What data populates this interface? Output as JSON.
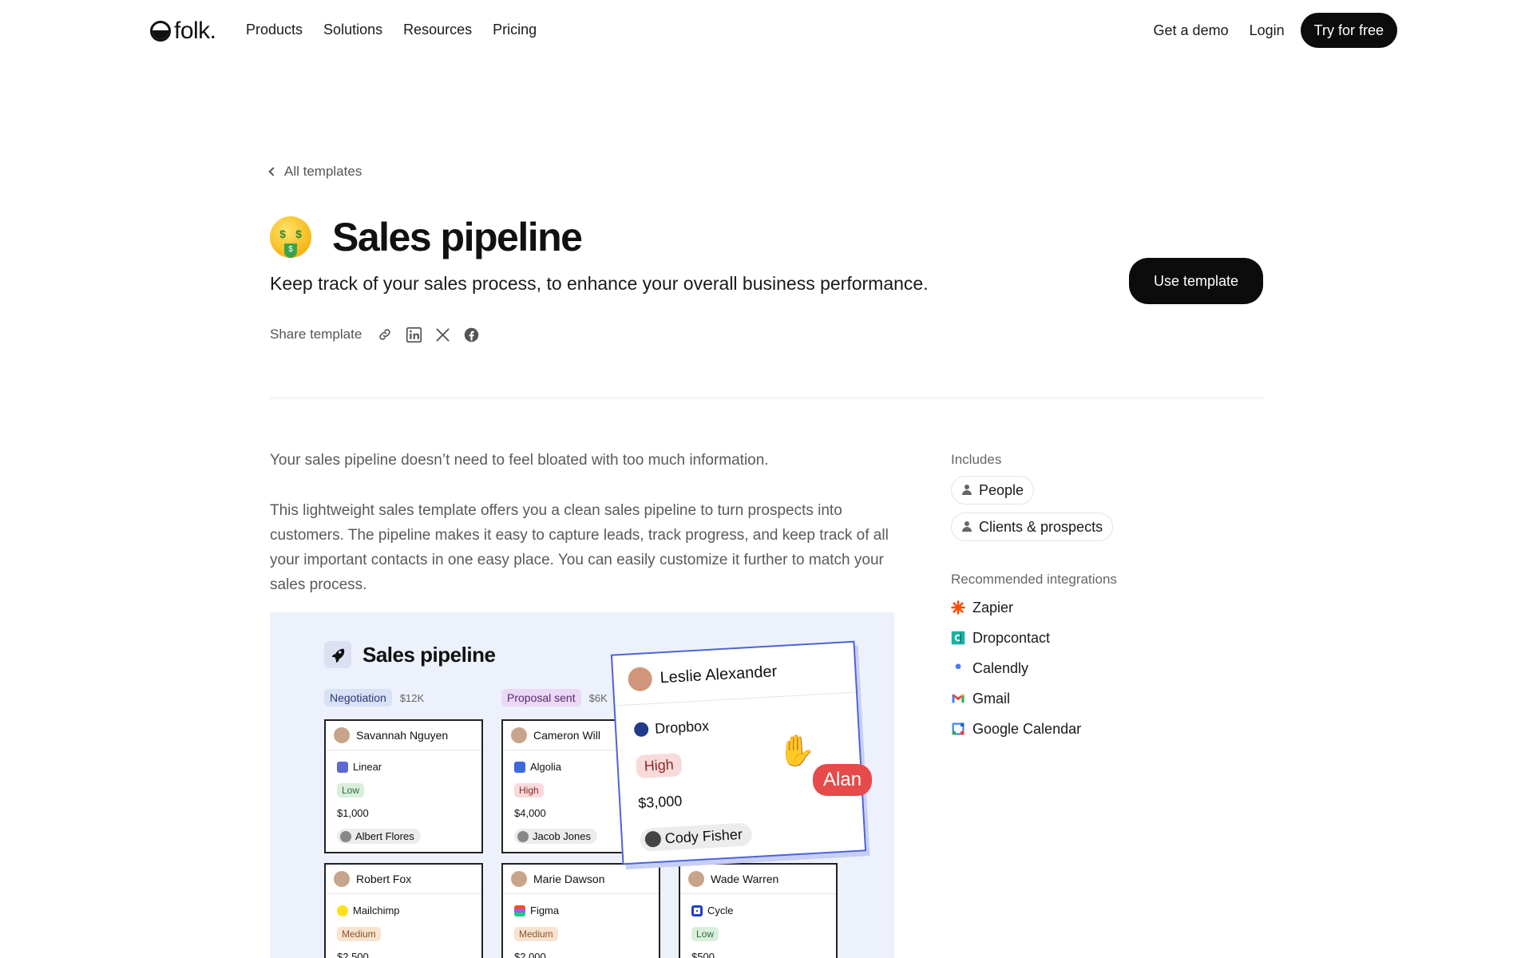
{
  "nav": {
    "logo_text": "folk.",
    "links": [
      "Products",
      "Solutions",
      "Resources",
      "Pricing"
    ],
    "demo": "Get a demo",
    "login": "Login",
    "cta": "Try for free"
  },
  "header": {
    "back": "All templates",
    "title": "Sales pipeline",
    "subtitle": "Keep track of your sales process, to enhance your overall business performance.",
    "use_template": "Use template",
    "share_label": "Share template"
  },
  "body": {
    "intro": "Your sales pipeline doesn’t need to feel bloated with too much information.",
    "description": "This lightweight sales template offers you a clean sales pipeline to turn prospects into customers. The pipeline makes it easy to capture leads, track progress, and keep track of all your important contacts in one easy place. You can easily customize it further to match your sales process."
  },
  "sidebar": {
    "includes_label": "Includes",
    "includes": [
      "People",
      "Clients & prospects"
    ],
    "integrations_label": "Recommended integrations",
    "integrations": [
      "Zapier",
      "Dropcontact",
      "Calendly",
      "Gmail",
      "Google Calendar"
    ]
  },
  "preview": {
    "title": "Sales pipeline",
    "columns": [
      {
        "stage": "Negotiation",
        "amount": "$12K"
      },
      {
        "stage": "Proposal sent",
        "amount": "$6K"
      }
    ],
    "cards": [
      {
        "name": "Savannah Nguyen",
        "company": "Linear",
        "priority": "Low",
        "value": "$1,000",
        "owner": "Albert Flores"
      },
      {
        "name": "Cameron Will",
        "company": "Algolia",
        "priority": "High",
        "value": "$4,000",
        "owner": "Jacob Jones"
      },
      {
        "name": "Robert Fox",
        "company": "Mailchimp",
        "priority": "Medium",
        "value": "$2,500"
      },
      {
        "name": "Marie Dawson",
        "company": "Figma",
        "priority": "Medium",
        "value": "$2,000"
      },
      {
        "name": "Wade Warren",
        "company": "Cycle",
        "priority": "Low",
        "value": "$500"
      }
    ],
    "floating_card": {
      "name": "Leslie Alexander",
      "company": "Dropbox",
      "priority": "High",
      "value": "$3,000",
      "owner": "Cody Fisher"
    },
    "cursor_label": "Alan"
  },
  "colors": {
    "accent_dark": "#0c0c0c",
    "float_border": "#4d63d8",
    "cursor_tag": "#e74a4a"
  }
}
